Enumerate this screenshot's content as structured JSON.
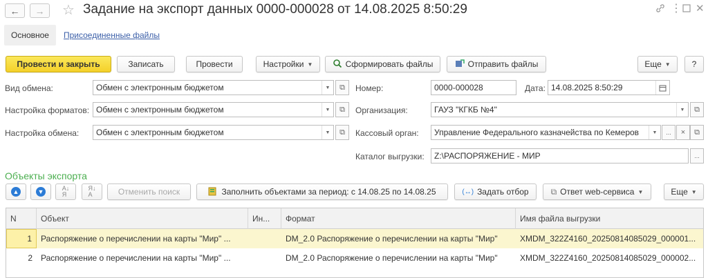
{
  "window": {
    "title": "Задание на экспорт данных 0000-000028 от 14.08.2025 8:50:29",
    "back_icon": "arrow-left-icon",
    "forward_icon": "arrow-right-icon",
    "star_icon": "star-icon",
    "link_icon": "link-icon",
    "menu_icon": "more-vertical-icon",
    "maximize_icon": "maximize-icon",
    "close_icon": "close-icon"
  },
  "tabs": {
    "main": "Основное",
    "attached": "Присоединенные файлы"
  },
  "toolbar": {
    "post_close": "Провести и закрыть",
    "save": "Записать",
    "post": "Провести",
    "settings": "Настройки",
    "generate": "Сформировать файлы",
    "send": "Отправить файлы",
    "more": "Еще",
    "help": "?"
  },
  "form": {
    "exchange_type": {
      "label": "Вид обмена:",
      "value": "Обмен с электронным бюджетом"
    },
    "format_settings": {
      "label": "Настройка форматов:",
      "value": "Обмен с электронным бюджетом"
    },
    "exchange_settings": {
      "label": "Настройка обмена:",
      "value": "Обмен с электронным бюджетом"
    },
    "number": {
      "label": "Номер:",
      "value": "0000-000028"
    },
    "date": {
      "label": "Дата:",
      "value": "14.08.2025  8:50:29"
    },
    "organization": {
      "label": "Организация:",
      "value": "ГАУЗ \"КГКБ №4\""
    },
    "treasury": {
      "label": "Кассовый орган:",
      "value": "Управление Федерального казначейства по Кемеров"
    },
    "export_dir": {
      "label": "Каталог выгрузки:",
      "value": "Z:\\РАСПОРЯЖЕНИЕ - МИР"
    }
  },
  "objects": {
    "section_title": "Объекты экспорта",
    "cancel_search": "Отменить поиск",
    "fill_period": "Заполнить объектами за период: с 14.08.25 по 14.08.25",
    "set_filter": "Задать отбор",
    "web_response": "Ответ web-сервиса",
    "more": "Еще",
    "columns": [
      "N",
      "Объект",
      "Ин...",
      "Формат",
      "Имя файла выгрузки"
    ],
    "rows": [
      {
        "n": "1",
        "object": "Распоряжение о перечислении на карты \"Мир\" ...",
        "in": "",
        "format": "DM_2.0 Распоряжение о перечислении на карты \"Мир\"",
        "file": "XMDM_322Z4160_20250814085029_000001..."
      },
      {
        "n": "2",
        "object": "Распоряжение о перечислении на карты \"Мир\" ...",
        "in": "",
        "format": "DM_2.0 Распоряжение о перечислении на карты \"Мир\"",
        "file": "XMDM_322Z4160_20250814085029_000002..."
      }
    ]
  },
  "colors": {
    "accent_yellow": "#f4d02a",
    "section_green": "#4caf50",
    "link_blue": "#3b5fa8",
    "selected_row": "#fbf6cf"
  }
}
